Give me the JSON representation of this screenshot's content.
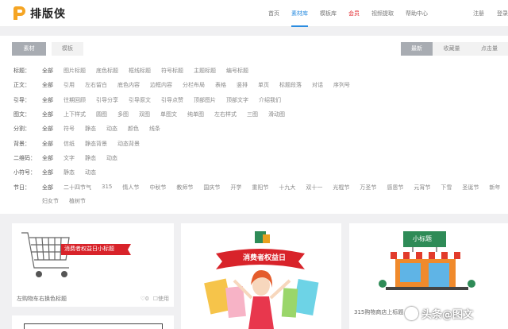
{
  "brand": {
    "name": "排版侠"
  },
  "nav": [
    {
      "label": "首页"
    },
    {
      "label": "素材库"
    },
    {
      "label": "模板库"
    },
    {
      "label": "会员"
    },
    {
      "label": "视频提取"
    },
    {
      "label": "帮助中心"
    }
  ],
  "auth": {
    "register": "注册",
    "login": "登录"
  },
  "toggles": {
    "sucai": "素材",
    "moban": "模板"
  },
  "sort": {
    "newest": "最新",
    "favorites": "收藏量",
    "clicks": "点击量"
  },
  "filters": [
    {
      "label": "标题：",
      "options": [
        "全部",
        "图片标题",
        "底色标题",
        "框线标题",
        "符号标题",
        "主题标题",
        "编号标题"
      ]
    },
    {
      "label": "正文：",
      "options": [
        "全部",
        "引用",
        "左右留白",
        "底色内容",
        "边框内容",
        "分栏布局",
        "表格",
        "竖排",
        "单页",
        "标题段落",
        "对话",
        "序列号"
      ]
    },
    {
      "label": "引导：",
      "options": [
        "全部",
        "往期回顾",
        "引导分享",
        "引导原文",
        "引导点赞",
        "顶部图片",
        "顶部文字",
        "介绍我们"
      ]
    },
    {
      "label": "图文：",
      "options": [
        "全部",
        "上下样式",
        "圆图",
        "多图",
        "双图",
        "单图文",
        "纯单图",
        "左右样式",
        "三图",
        "滑动图"
      ]
    },
    {
      "label": "分割：",
      "options": [
        "全部",
        "符号",
        "静态",
        "动态",
        "颜色",
        "线条"
      ]
    },
    {
      "label": "背景：",
      "options": [
        "全部",
        "信纸",
        "静态背景",
        "动态背景"
      ]
    },
    {
      "label": "二维码：",
      "options": [
        "全部",
        "文字",
        "静态",
        "动态"
      ]
    },
    {
      "label": "小符号：",
      "options": [
        "全部",
        "静态",
        "动态"
      ]
    },
    {
      "label": "节日：",
      "options": [
        "全部",
        "二十四节气",
        "315",
        "情人节",
        "中秋节",
        "教师节",
        "国庆节",
        "开学",
        "重阳节",
        "十九大",
        "双十一",
        "光棍节",
        "万圣节",
        "感恩节",
        "元宵节",
        "下雪",
        "圣诞节",
        "新年"
      ]
    },
    {
      "label": "",
      "options": [
        "妇女节",
        "植树节"
      ]
    }
  ],
  "cards": [
    {
      "banner": "消费者权益日小标题",
      "caption": "左购物车右换色标题",
      "likes": "0",
      "use_label": "使用"
    },
    {
      "banner": "消费者权益日"
    },
    {
      "banner": "小标题",
      "caption": "315购物商店上标题"
    },
    {}
  ],
  "watermark": {
    "text": "头条@图文"
  },
  "colors": {
    "accent": "#2a8ce0",
    "vip": "#e2242a",
    "logo": "#f5a524",
    "banner": "#d8232a"
  }
}
